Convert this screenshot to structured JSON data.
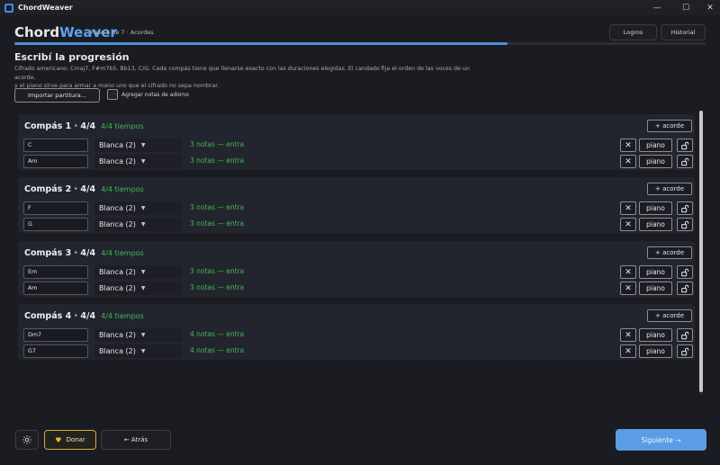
{
  "window": {
    "title": "ChordWeaver",
    "controls": {
      "minimize": "—",
      "maximize": "☐",
      "close": "✕"
    }
  },
  "header": {
    "brand_part1": "Chord",
    "brand_part2": "Weaver",
    "step_text": "Paso 5 de 7 · Acordes",
    "logros_label": "Logros",
    "historial_label": "Historial",
    "progress_fraction": 0.714
  },
  "page": {
    "title": "Escribí la progresión",
    "description_line1": "Cifrado americano: Cmaj7, F#m7b5, Bb13, C/G. Cada compás tiene que llenarse exacto con las duraciones elegidas. El candado fija el orden de las voces de un acorde,",
    "description_line2": "y el piano sirve para armar a mano uno que el cifrado no sepa nombrar.",
    "import_label": "Importar partitura...",
    "ornament_label": "Agregar notas de adorno"
  },
  "measures": [
    {
      "title": "Compás 1 · 4/4",
      "time_status": "4/4 tiempos",
      "add_label": "+ acorde",
      "chords": [
        {
          "symbol": "C",
          "duration": "Blanca (2)",
          "notes": "3 notas — entra"
        },
        {
          "symbol": "Am",
          "duration": "Blanca (2)",
          "notes": "3 notas — entra"
        }
      ]
    },
    {
      "title": "Compás 2 · 4/4",
      "time_status": "4/4 tiempos",
      "add_label": "+ acorde",
      "chords": [
        {
          "symbol": "F",
          "duration": "Blanca (2)",
          "notes": "3 notas — entra"
        },
        {
          "symbol": "G",
          "duration": "Blanca (2)",
          "notes": "3 notas — entra"
        }
      ]
    },
    {
      "title": "Compás 3 · 4/4",
      "time_status": "4/4 tiempos",
      "add_label": "+ acorde",
      "chords": [
        {
          "symbol": "Em",
          "duration": "Blanca (2)",
          "notes": "3 notas — entra"
        },
        {
          "symbol": "Am",
          "duration": "Blanca (2)",
          "notes": "3 notas — entra"
        }
      ]
    },
    {
      "title": "Compás 4 · 4/4",
      "time_status": "4/4 tiempos",
      "add_label": "+ acorde",
      "chords": [
        {
          "symbol": "Dm7",
          "duration": "Blanca (2)",
          "notes": "4 notas — entra"
        },
        {
          "symbol": "G7",
          "duration": "Blanca (2)",
          "notes": "4 notas — entra"
        }
      ]
    }
  ],
  "row_buttons": {
    "remove": "✕",
    "piano": "piano"
  },
  "footer": {
    "donar_label": "Donar",
    "donar_icon": "♥",
    "atras_label": "← Atrás",
    "siguiente_label": "Siguiente →"
  },
  "colors": {
    "accent": "#5b9ce6",
    "ok_green": "#3fb950",
    "donate_gold": "#d9a93a",
    "background": "#1b1c22"
  }
}
